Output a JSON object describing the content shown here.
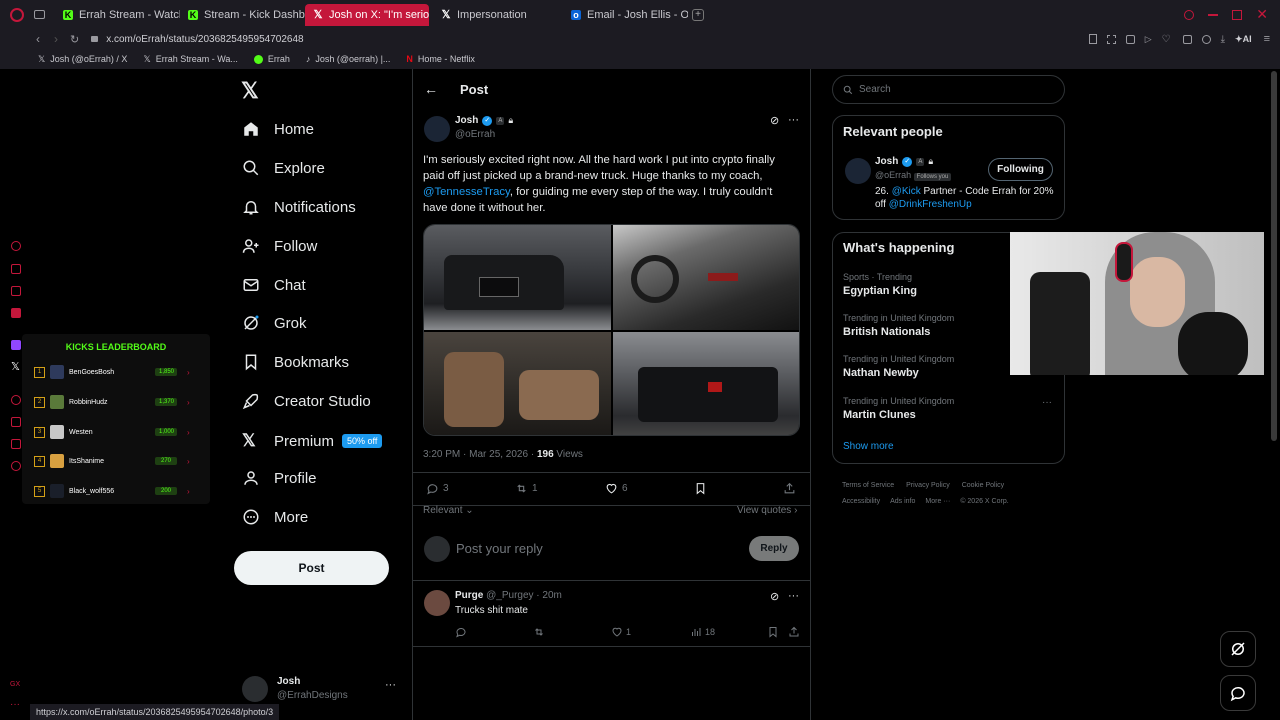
{
  "browser": {
    "tabs": [
      {
        "label": "Errah Stream - Watch Live",
        "color": "#53fc18"
      },
      {
        "label": "Stream - Kick Dashboard",
        "color": "#53fc18"
      },
      {
        "label": "Josh on X: \"I'm seriously e",
        "color": "#000000"
      },
      {
        "label": "Impersonation",
        "color": "#000000"
      },
      {
        "label": "Email - Josh Ellis - Outlook",
        "color": "#0a64d6"
      }
    ],
    "url": "x.com/oErrah/status/2036825495954702648",
    "bookmarks": [
      "Josh (@oErrah) / X",
      "Errah Stream - Wa...",
      "Errah",
      "Josh (@oerrah) |...",
      "Home - Netflix"
    ],
    "status_url": "https://x.com/oErrah/status/2036825495954702648/photo/3",
    "ai_label": "AI"
  },
  "leaderboard": {
    "title": "KICKS LEADERBOARD",
    "rows": [
      {
        "rank": "1",
        "name": "BenGoesBosh",
        "score": "1,850"
      },
      {
        "rank": "2",
        "name": "RobbinHudz",
        "score": "1,370"
      },
      {
        "rank": "3",
        "name": "Westen",
        "score": "1,000"
      },
      {
        "rank": "4",
        "name": "ItsShanime",
        "score": "270"
      },
      {
        "rank": "5",
        "name": "Black_wolf556",
        "score": "200"
      }
    ]
  },
  "nav": {
    "items": [
      "Home",
      "Explore",
      "Notifications",
      "Follow",
      "Chat",
      "Grok",
      "Bookmarks",
      "Creator Studio",
      "Premium",
      "Profile",
      "More"
    ],
    "premium_badge": "50% off",
    "post_button": "Post",
    "account": {
      "name": "Josh",
      "handle": "@ErrahDesigns"
    }
  },
  "post": {
    "header": "Post",
    "author": {
      "name": "Josh",
      "handle": "@oErrah",
      "badge": "A"
    },
    "text_1": "I'm seriously excited right now. All the hard work I put into crypto finally paid off just picked up a brand-new truck. Huge thanks to my coach,",
    "mention": "@TennesseTracy",
    "text_2": ", for guiding me every step of the way. I truly couldn't have done it without her.",
    "time": "3:20 PM · Mar 25, 2026 · ",
    "views_count": "196",
    "views_label": " Views",
    "replies": "3",
    "reposts": "1",
    "likes": "6",
    "sort": "Relevant",
    "view_quotes": "View quotes",
    "reply_placeholder": "Post your reply",
    "reply_button": "Reply"
  },
  "reply": {
    "name": "Purge",
    "handle": "@_Purgey · 20m",
    "text": "Trucks shit mate",
    "likes": "1",
    "views": "18"
  },
  "right": {
    "search_placeholder": "Search",
    "relevant_title": "Relevant people",
    "person": {
      "name": "Josh",
      "handle": "@oErrah",
      "badge": "A",
      "follows_you": "Follows you",
      "follow_button": "Following",
      "bio_1": "26. ",
      "bio_kick": "@Kick",
      "bio_2": " Partner - Code Errah for 20% off ",
      "bio_link": "@DrinkFreshenUp"
    },
    "happening_title": "What's happening",
    "trends": [
      {
        "meta": "Sports · Trending",
        "name": "Egyptian King"
      },
      {
        "meta": "Trending in United Kingdom",
        "name": "British Nationals"
      },
      {
        "meta": "Trending in United Kingdom",
        "name": "Nathan Newby"
      },
      {
        "meta": "Trending in United Kingdom",
        "name": "Martin Clunes"
      }
    ],
    "show_more": "Show more",
    "footer": [
      "Terms of Service",
      "Privacy Policy",
      "Cookie Policy",
      "Accessibility",
      "Ads info",
      "More ···",
      "© 2026 X Corp."
    ]
  },
  "colors": {
    "accent": "#1d9bf0",
    "opera": "#c4173b",
    "kick": "#53fc18"
  }
}
